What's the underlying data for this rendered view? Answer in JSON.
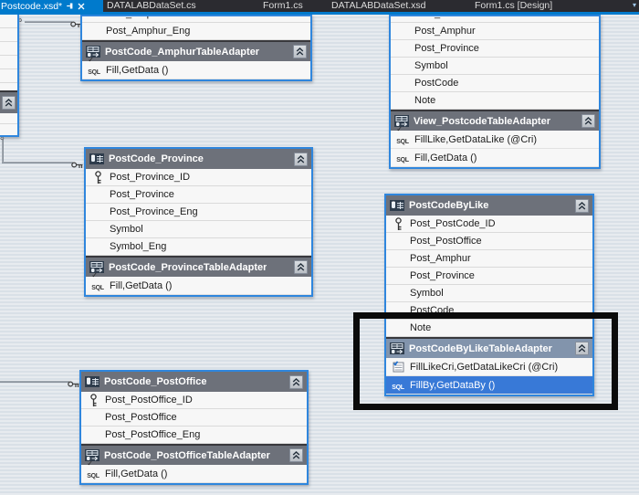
{
  "tabbar": {
    "active_tab": {
      "label": "Postcode.xsd*"
    },
    "tabs": [
      "DATALABDataSet.cs",
      "Form1.cs",
      "DATALABDataSet.xsd",
      "Form1.cs [Design]"
    ],
    "overflow_glyph": "▾"
  },
  "colors": {
    "tab_accent": "#007acc",
    "selection_blue": "#3879d7",
    "header_gray": "#6d717a",
    "adapter_selected_header": "#8294ac",
    "box_border_blue": "#2f86dd",
    "annotation_black": "#0b0b0b"
  },
  "icons": [
    "pin-icon",
    "close-icon",
    "datatable-icon",
    "tableadapter-icon",
    "collapse-chevron-icon",
    "primary-key-icon",
    "sql-icon",
    "sql-check-icon",
    "query-grid-icon",
    "relation-key-icon",
    "relation-many-icon"
  ],
  "boxes": [
    {
      "id": "amphur",
      "columns": [
        {
          "label": "Post_Amphur",
          "clipped": true
        },
        {
          "label": "Post_Amphur_Eng"
        }
      ],
      "adapter": {
        "title": "PostCode_AmphurTableAdapter"
      },
      "queries": [
        {
          "label": "Fill,GetData ()",
          "icon": "sql-check-icon"
        }
      ]
    },
    {
      "id": "view",
      "columns": [
        {
          "label": "Post_PostOffice",
          "clipped": true
        },
        {
          "label": "Post_Amphur"
        },
        {
          "label": "Post_Province"
        },
        {
          "label": "Symbol"
        },
        {
          "label": "PostCode"
        },
        {
          "label": "Note"
        }
      ],
      "adapter": {
        "title": "View_PostcodeTableAdapter"
      },
      "queries": [
        {
          "label": "FillLike,GetDataLike (@Cri)",
          "icon": "sql-check-icon"
        },
        {
          "label": "Fill,GetData ()",
          "icon": "sql-icon"
        }
      ]
    },
    {
      "id": "province",
      "title": "PostCode_Province",
      "columns": [
        {
          "label": "Post_Province_ID",
          "key": true
        },
        {
          "label": "Post_Province"
        },
        {
          "label": "Post_Province_Eng"
        },
        {
          "label": "Symbol"
        },
        {
          "label": "Symbol_Eng"
        }
      ],
      "adapter": {
        "title": "PostCode_ProvinceTableAdapter"
      },
      "queries": [
        {
          "label": "Fill,GetData ()",
          "icon": "sql-check-icon"
        }
      ]
    },
    {
      "id": "bylike",
      "title": "PostCodeByLike",
      "columns": [
        {
          "label": "Post_PostCode_ID",
          "key": true
        },
        {
          "label": "Post_PostOffice"
        },
        {
          "label": "Post_Amphur"
        },
        {
          "label": "Post_Province"
        },
        {
          "label": "Symbol"
        },
        {
          "label": "PostCode"
        },
        {
          "label": "Note"
        }
      ],
      "adapter": {
        "title": "PostCodeByLikeTableAdapter",
        "selected": true
      },
      "queries": [
        {
          "label": "FillLikeCri,GetDataLikeCri (@Cri)",
          "icon": "query-grid-icon"
        },
        {
          "label": "FillBy,GetDataBy ()",
          "icon": "sql-icon",
          "selected": true
        }
      ]
    },
    {
      "id": "postoffice",
      "title": "PostCode_PostOffice",
      "columns": [
        {
          "label": "Post_PostOffice_ID",
          "key": true
        },
        {
          "label": "Post_PostOffice"
        },
        {
          "label": "Post_PostOffice_Eng"
        }
      ],
      "adapter": {
        "title": "PostCode_PostOfficeTableAdapter"
      },
      "queries": [
        {
          "label": "Fill,GetData ()",
          "icon": "sql-check-icon"
        }
      ]
    }
  ]
}
